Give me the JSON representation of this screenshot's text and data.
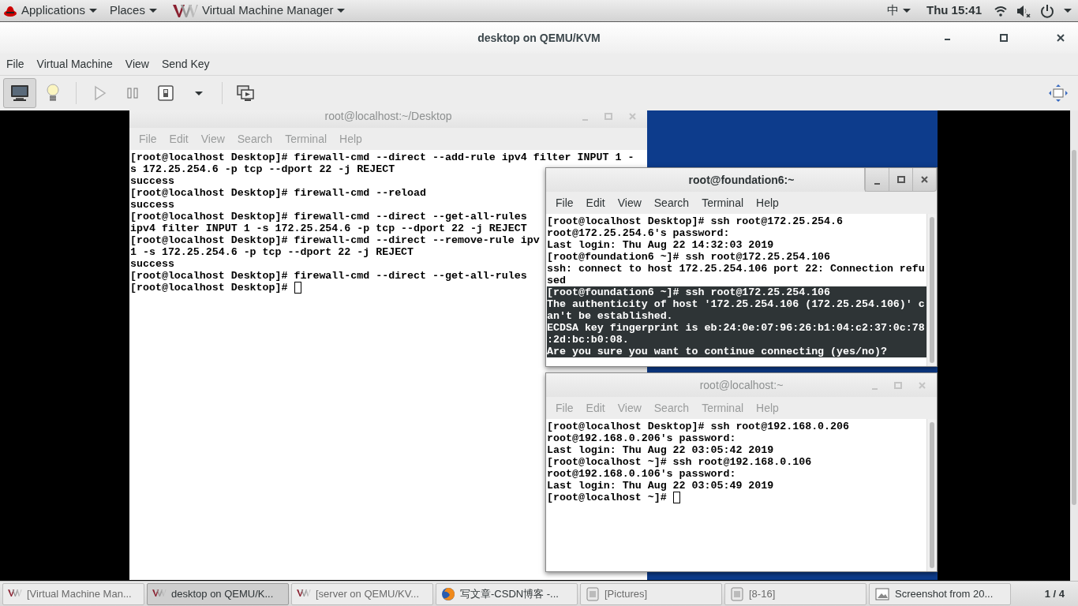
{
  "top_bar": {
    "menus": [
      {
        "label": "Applications",
        "kind": "apps"
      },
      {
        "label": "Places",
        "kind": "plain"
      },
      {
        "label": "Virtual Machine Manager",
        "kind": "vm"
      }
    ],
    "input_method": "中",
    "clock": "Thu 15:41"
  },
  "window": {
    "title": "desktop on QEMU/KVM",
    "menu": [
      "File",
      "Virtual Machine",
      "View",
      "Send Key"
    ],
    "toolbar": [
      [
        {
          "kind": "console",
          "selected": true,
          "disabled": false
        },
        {
          "kind": "details",
          "selected": false,
          "disabled": false
        }
      ],
      [
        {
          "kind": "run",
          "selected": false,
          "disabled": true
        },
        {
          "kind": "pause",
          "selected": false,
          "disabled": false
        },
        {
          "kind": "shutdown",
          "selected": false,
          "disabled": false
        },
        {
          "kind": "caret",
          "selected": false,
          "disabled": false
        }
      ],
      [
        {
          "kind": "snapshots",
          "selected": false,
          "disabled": false
        }
      ]
    ]
  },
  "terminals": [
    {
      "title": "root@localhost:~/Desktop",
      "active": false,
      "cursor": true,
      "menu": [
        "File",
        "Edit",
        "View",
        "Search",
        "Terminal",
        "Help"
      ],
      "lines": [
        {
          "text": "[root@localhost Desktop]# firewall-cmd --direct --add-rule ipv4 filter INPUT 1 -",
          "selected": false
        },
        {
          "text": "s 172.25.254.6 -p tcp --dport 22 -j REJECT",
          "selected": false
        },
        {
          "text": "success",
          "selected": false
        },
        {
          "text": "[root@localhost Desktop]# firewall-cmd --reload",
          "selected": false
        },
        {
          "text": "success",
          "selected": false
        },
        {
          "text": "[root@localhost Desktop]# firewall-cmd --direct --get-all-rules",
          "selected": false
        },
        {
          "text": "ipv4 filter INPUT 1 -s 172.25.254.6 -p tcp --dport 22 -j REJECT",
          "selected": false
        },
        {
          "text": "[root@localhost Desktop]# firewall-cmd --direct --remove-rule ipv",
          "selected": false
        },
        {
          "text": "1 -s 172.25.254.6 -p tcp --dport 22 -j REJECT",
          "selected": false
        },
        {
          "text": "success",
          "selected": false
        },
        {
          "text": "[root@localhost Desktop]# firewall-cmd --direct --get-all-rules",
          "selected": false
        },
        {
          "text": "[root@localhost Desktop]#",
          "selected": false
        }
      ]
    },
    {
      "title": "root@foundation6:~",
      "active": true,
      "cursor": false,
      "menu": [
        "File",
        "Edit",
        "View",
        "Search",
        "Terminal",
        "Help"
      ],
      "lines": [
        {
          "text": "[root@localhost Desktop]# ssh root@172.25.254.6",
          "selected": false
        },
        {
          "text": "root@172.25.254.6's password:",
          "selected": false
        },
        {
          "text": "Last login: Thu Aug 22 14:32:03 2019",
          "selected": false
        },
        {
          "text": "[root@foundation6 ~]# ssh root@172.25.254.106",
          "selected": false
        },
        {
          "text": "ssh: connect to host 172.25.254.106 port 22: Connection refu",
          "selected": false
        },
        {
          "text": "sed",
          "selected": false
        },
        {
          "text": "[root@foundation6 ~]# ssh root@172.25.254.106",
          "selected": true
        },
        {
          "text": "The authenticity of host '172.25.254.106 (172.25.254.106)' c",
          "selected": true
        },
        {
          "text": "an't be established.",
          "selected": true
        },
        {
          "text": "ECDSA key fingerprint is eb:24:0e:07:96:26:b1:04:c2:37:0c:78",
          "selected": true
        },
        {
          "text": ":2d:bc:b0:08.",
          "selected": true
        },
        {
          "text": "Are you sure you want to continue connecting (yes/no)?",
          "selected": true
        }
      ]
    },
    {
      "title": "root@localhost:~",
      "active": false,
      "cursor": true,
      "menu": [
        "File",
        "Edit",
        "View",
        "Search",
        "Terminal",
        "Help"
      ],
      "lines": [
        {
          "text": "[root@localhost Desktop]# ssh root@192.168.0.206",
          "selected": false
        },
        {
          "text": "root@192.168.0.206's password:",
          "selected": false
        },
        {
          "text": "Last login: Thu Aug 22 03:05:42 2019",
          "selected": false
        },
        {
          "text": "[root@localhost ~]# ssh root@192.168.0.106",
          "selected": false
        },
        {
          "text": "root@192.168.0.106's password:",
          "selected": false
        },
        {
          "text": "Last login: Thu Aug 22 03:05:49 2019",
          "selected": false
        },
        {
          "text": "[root@localhost ~]#",
          "selected": false
        }
      ]
    }
  ],
  "taskbar": {
    "items": [
      {
        "label": "[Virtual Machine Man...",
        "kind": "vm",
        "selected": false
      },
      {
        "label": "desktop on QEMU/K...",
        "kind": "vm",
        "selected": true
      },
      {
        "label": "[server on QEMU/KV...",
        "kind": "vm",
        "selected": false
      },
      {
        "label": "写文章-CSDN博客 -...",
        "kind": "browser",
        "selected": false
      },
      {
        "label": "[Pictures]",
        "kind": "files",
        "selected": false
      },
      {
        "label": "[8-16]",
        "kind": "files",
        "selected": false
      },
      {
        "label": "Screenshot from 20...",
        "kind": "image",
        "selected": false
      }
    ],
    "pager": "1 / 4"
  }
}
